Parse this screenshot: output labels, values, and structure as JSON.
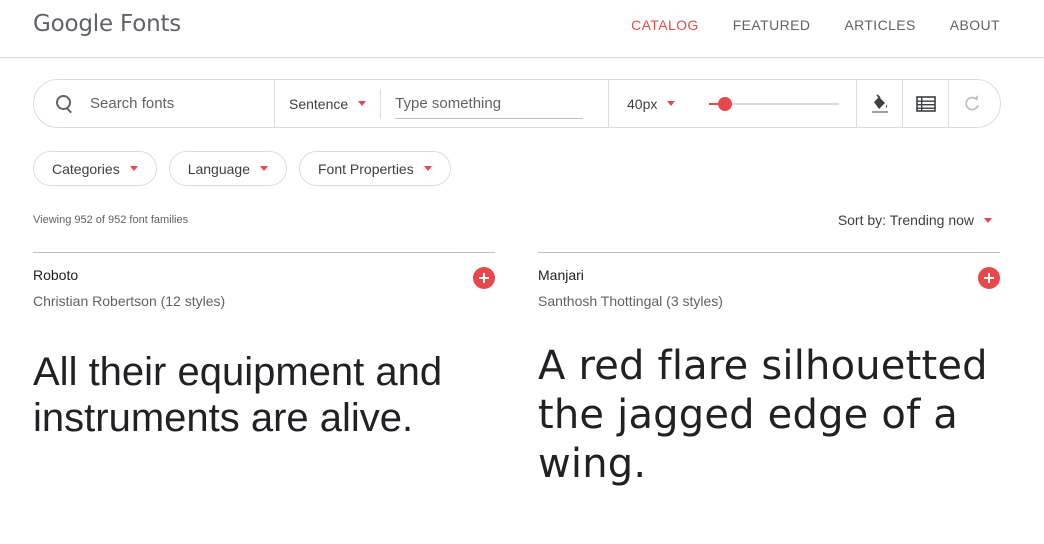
{
  "header": {
    "logo": "Google Fonts",
    "nav": [
      "CATALOG",
      "FEATURED",
      "ARTICLES",
      "ABOUT"
    ],
    "active_nav": "CATALOG"
  },
  "toolbar": {
    "search_placeholder": "Search fonts",
    "preview_mode": "Sentence",
    "type_placeholder": "Type something",
    "font_size": "40px",
    "slider_level": 0.12,
    "icons": [
      "paint-bucket-icon",
      "list-view-icon",
      "refresh-icon"
    ]
  },
  "filters": [
    "Categories",
    "Language",
    "Font Properties"
  ],
  "viewing": "Viewing 952 of 952 font families",
  "sort": "Sort by: Trending now",
  "fonts": [
    {
      "name": "Roboto",
      "author": "Christian Robertson (12 styles)",
      "sample": "All their equipment and instruments are alive."
    },
    {
      "name": "Manjari",
      "author": "Santhosh Thottingal (3 styles)",
      "sample": "A red flare silhouetted the jagged edge of a wing."
    }
  ],
  "colors": {
    "accent": "#e8484a",
    "text": "#3c4043",
    "muted": "#5f6368",
    "border": "#dadce0"
  }
}
